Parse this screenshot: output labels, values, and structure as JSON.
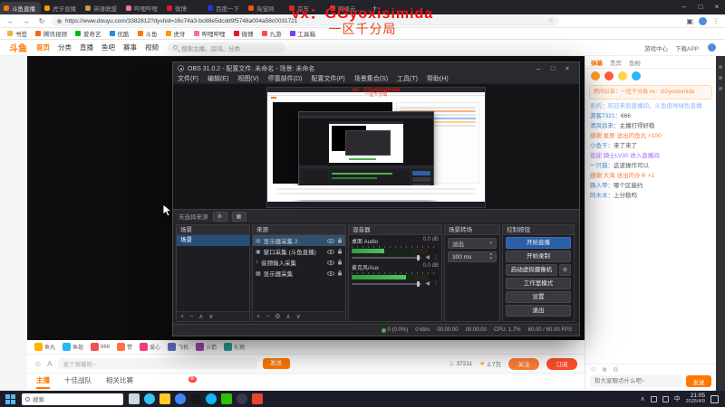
{
  "overlay": {
    "line1": "vx：GGyoxisimida",
    "line2": "一区千分局"
  },
  "icons": {
    "back": "←",
    "forward": "→",
    "reload": "↻",
    "star": "☆",
    "ext": "▣",
    "menu": "⋮",
    "chevron": "∧",
    "gear": "⚙",
    "grid": "▦",
    "plus": "+",
    "minus": "−",
    "up": "∧",
    "down": "∨",
    "dots": "⋮",
    "arrow_down": "▾",
    "spin_up": "▴",
    "spin_down": "▾",
    "speaker": "◀",
    "emoji": "☺",
    "font": "A",
    "gift": "❀",
    "flame": "♨",
    "fav_star": "★"
  },
  "browser": {
    "tabs": [
      {
        "label": "斗鱼直播",
        "color": "#ff7700"
      },
      {
        "label": "虎牙直播",
        "color": "#ff9900"
      },
      {
        "label": "英雄联盟",
        "color": "#c89b3c"
      },
      {
        "label": "哔哩哔哩",
        "color": "#fb7299"
      },
      {
        "label": "微博",
        "color": "#e6162d"
      },
      {
        "label": "百度一下",
        "color": "#2932e1"
      },
      {
        "label": "淘宝网",
        "color": "#ff5000"
      },
      {
        "label": "京东",
        "color": "#e1251b"
      },
      {
        "label": "网易云音乐",
        "color": "#d43c33"
      }
    ],
    "new_tab_label": "+",
    "window_controls": {
      "minimize": "–",
      "maximize": "□",
      "close": "×"
    },
    "url": "https://www.douyu.com/3382812?dyshid=16c74a3-bc88e5dcdd9f5748a004a58c0031721"
  },
  "bookmarks": [
    {
      "label": "书签",
      "color": "#f5b041"
    },
    {
      "label": "腾讯视频",
      "color": "#ff6022"
    },
    {
      "label": "爱奇艺",
      "color": "#00be06"
    },
    {
      "label": "优酷",
      "color": "#1f8fe5"
    },
    {
      "label": "斗鱼",
      "color": "#ff7700"
    },
    {
      "label": "虎牙",
      "color": "#ff9900"
    },
    {
      "label": "哔哩哔哩",
      "color": "#fb7299"
    },
    {
      "label": "微博",
      "color": "#e6162d"
    },
    {
      "label": "九游",
      "color": "#ff4f4f"
    },
    {
      "label": "工具箱",
      "color": "#7d3cff"
    }
  ],
  "site": {
    "logo": "斗鱼",
    "nav": [
      "首页",
      "分类",
      "直播",
      "鱼吧",
      "赛事",
      "视频"
    ],
    "search_placeholder": "搜索主播、房间、分类",
    "header_links": [
      "游戏中心",
      "下载APP"
    ],
    "gift_bar": [
      {
        "label": "鱼丸",
        "color": "#ffb300"
      },
      {
        "label": "鱼翅",
        "color": "#29b6f6"
      },
      {
        "label": "666",
        "color": "#ef5350"
      },
      {
        "label": "赞",
        "color": "#ff7043"
      },
      {
        "label": "爱心",
        "color": "#ec407a"
      },
      {
        "label": "飞机",
        "color": "#5c6bc0"
      },
      {
        "label": "火箭",
        "color": "#ab47bc"
      },
      {
        "label": "礼物",
        "color": "#26a69a"
      }
    ],
    "danmu": {
      "placeholder": "发个弹幕呗~",
      "send": "发送"
    },
    "stats": {
      "heat": "37211",
      "fans": "2.7万"
    },
    "buttons": {
      "follow": "关注",
      "subscribe": "订阅"
    },
    "bottom_tabs": [
      "主播",
      "十佳战队",
      "相关比赛"
    ],
    "tab_badge": "新",
    "chat": {
      "tabs": [
        "弹幕",
        "贵宾",
        "鱼粉"
      ],
      "activity": [
        {
          "color": "#ff9d2b"
        },
        {
          "color": "#ff5e3a"
        },
        {
          "color": "#ffd54f"
        },
        {
          "color": "#29b6f6"
        }
      ],
      "announcement": "房间公告：一区千分局 vx：GGyoxisimida",
      "messages": [
        {
          "user": "",
          "text": "系统：欢迎来到直播间，斗鱼倡导绿色直播",
          "color": "#8ab4ff"
        },
        {
          "user": "游客7321：",
          "text": "666",
          "color": "#555555"
        },
        {
          "user": "清风徐来：",
          "text": "主播打得好稳",
          "color": "#555555"
        },
        {
          "user": "",
          "text": "感谢 星辰 送出的鱼丸 ×100",
          "color": "#ff7d37"
        },
        {
          "user": "小鱼干：",
          "text": "来了来了",
          "color": "#555555"
        },
        {
          "user": "",
          "text": "欢迎 骑士LV30 进入直播间",
          "color": "#a06bff"
        },
        {
          "user": "一只猫：",
          "text": "这波操作可以",
          "color": "#555555"
        },
        {
          "user": "",
          "text": "感谢 大海 送出的办卡 ×1",
          "color": "#ff7d37"
        },
        {
          "user": "路人甲：",
          "text": "哪个区能约",
          "color": "#555555"
        },
        {
          "user": "阿木木：",
          "text": "上分稳吗",
          "color": "#555555"
        }
      ],
      "input_placeholder": "和大家聊点什么吧~",
      "send": "发送"
    }
  },
  "obs": {
    "title": "OBS 31.0.2 - 配置文件: 未命名 - 场景: 未命名",
    "window_controls": {
      "minimize": "–",
      "maximize": "□",
      "close": "×"
    },
    "menu": [
      "文件(F)",
      "编辑(E)",
      "视图(V)",
      "停靠部件(D)",
      "配置文件(P)",
      "场景集合(S)",
      "工具(T)",
      "帮助(H)"
    ],
    "srcbar_label": "未选择来源",
    "docks": {
      "scenes": {
        "title": "场景",
        "items": [
          "场景"
        ]
      },
      "sources": {
        "title": "来源",
        "items": [
          {
            "glyph": "▤",
            "name": "显示器采集 2"
          },
          {
            "glyph": "▣",
            "name": "窗口采集 (斗鱼直播)"
          },
          {
            "glyph": "♪",
            "name": "音频输入采集"
          },
          {
            "glyph": "▦",
            "name": "显示器采集"
          }
        ]
      },
      "mixer": {
        "title": "混音器",
        "channels": [
          {
            "name": "桌面 Audio",
            "db": "0.0 dB"
          },
          {
            "name": "麦克风/Aux",
            "db": "0.0 dB"
          }
        ]
      },
      "transitions": {
        "title": "场景转场",
        "transition": "淡出",
        "duration": "300 ms"
      },
      "controls": {
        "title": "控制按钮",
        "buttons": [
          "开始直播",
          "开始录制",
          "启动虚拟摄像机",
          "工作室模式",
          "设置",
          "退出"
        ]
      }
    },
    "status": {
      "dropped": "0 (0.0%)",
      "bitrate": "0 kb/s",
      "live": "00:00:00",
      "rec": "00:00:00",
      "cpu": "CPU: 1.7%",
      "fps": "60.00 / 60.00 FPS"
    }
  },
  "taskbar": {
    "search": "搜索",
    "icons": [
      {
        "name": "task-view",
        "color": "#cfd8dc",
        "radius": "2px"
      },
      {
        "name": "edge",
        "color": "#36c5f0",
        "radius": "50%"
      },
      {
        "name": "file-explorer",
        "color": "#ffca28",
        "radius": "2px"
      },
      {
        "name": "chrome",
        "color": "#4285f4",
        "radius": "50%"
      },
      {
        "name": "obs",
        "color": "#17171b",
        "radius": "50%"
      },
      {
        "name": "qq",
        "color": "#12b7f5",
        "radius": "50%"
      },
      {
        "name": "wechat",
        "color": "#2dc100",
        "radius": "2px"
      },
      {
        "name": "steam",
        "color": "#39394a",
        "radius": "50%"
      },
      {
        "name": "player",
        "color": "#e8452c",
        "radius": "2px"
      }
    ],
    "lang": "中",
    "time": "21:05",
    "date": "2025/4/9"
  }
}
